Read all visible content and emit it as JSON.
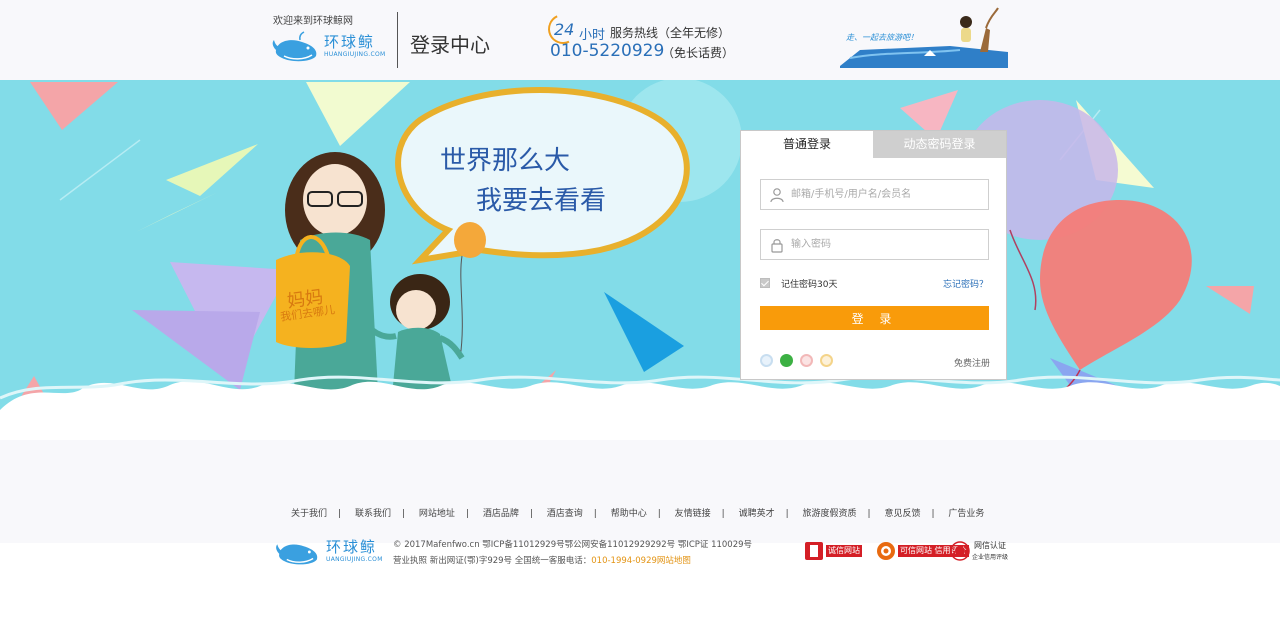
{
  "header": {
    "welcome": "欢迎来到环球鲸网",
    "logo_cn": "环球鲸",
    "logo_en": "HUANGIUJING.COM",
    "page_title": "登录中心",
    "hotline_24": "24",
    "hotline_hours": "小时",
    "hotline_service": "服务热线（全年无修）",
    "hotline_phone": "010-5220929",
    "hotline_free": "（免长话费）",
    "art_caption": "走、一起去旅游吧！"
  },
  "banner": {
    "slogan_line1": "世界那么大",
    "slogan_line2": "我要去看看",
    "bag_text1": "妈妈",
    "bag_text2": "我们去哪儿"
  },
  "login": {
    "tab_normal": "普通登录",
    "tab_dynamic": "动态密码登录",
    "username_placeholder": "邮箱/手机号/用户名/会员名",
    "password_placeholder": "输入密码",
    "remember_label": "记住密码30天",
    "forgot_link": "忘记密码？",
    "submit_label": "登 录",
    "register_link": "免费注册",
    "socials": [
      "qq-icon",
      "wechat-icon",
      "weibo-icon",
      "alipay-icon"
    ]
  },
  "footer": {
    "links": [
      "关于我们",
      "联系我们",
      "网站地址",
      "酒店品牌",
      "酒店查询",
      "帮助中心",
      "友情链接",
      "诚聘英才",
      "旅游度假资质",
      "意见反馈",
      "广告业务"
    ],
    "logo_cn": "环球鲸",
    "logo_en": "UANGIUJING.COM",
    "copyright_line1": "© 2017Mafenfwo.cn 鄂ICP备11012929号鄂公网安备11012929292号 鄂ICP证 110029号",
    "copyright_line2_prefix": "营业执照 新出网证(鄂)字929号 全国统一客服电话：",
    "copyright_line2_phone": "010-1994-0929",
    "copyright_line2_map": "网站地图",
    "badges": [
      {
        "icon": "trust-seal-icon",
        "text": "诚信网站"
      },
      {
        "icon": "credit-rating-icon",
        "text": "可信网站 信用评价"
      },
      {
        "icon": "cert-seal-icon",
        "text": "网信认证",
        "sub": "企业信用评级"
      }
    ]
  },
  "colors": {
    "accent_orange": "#f99b0a",
    "brand_blue": "#2a6fb8",
    "banner_sky": "#82dce8",
    "tab_inactive": "#cfcfcf"
  }
}
